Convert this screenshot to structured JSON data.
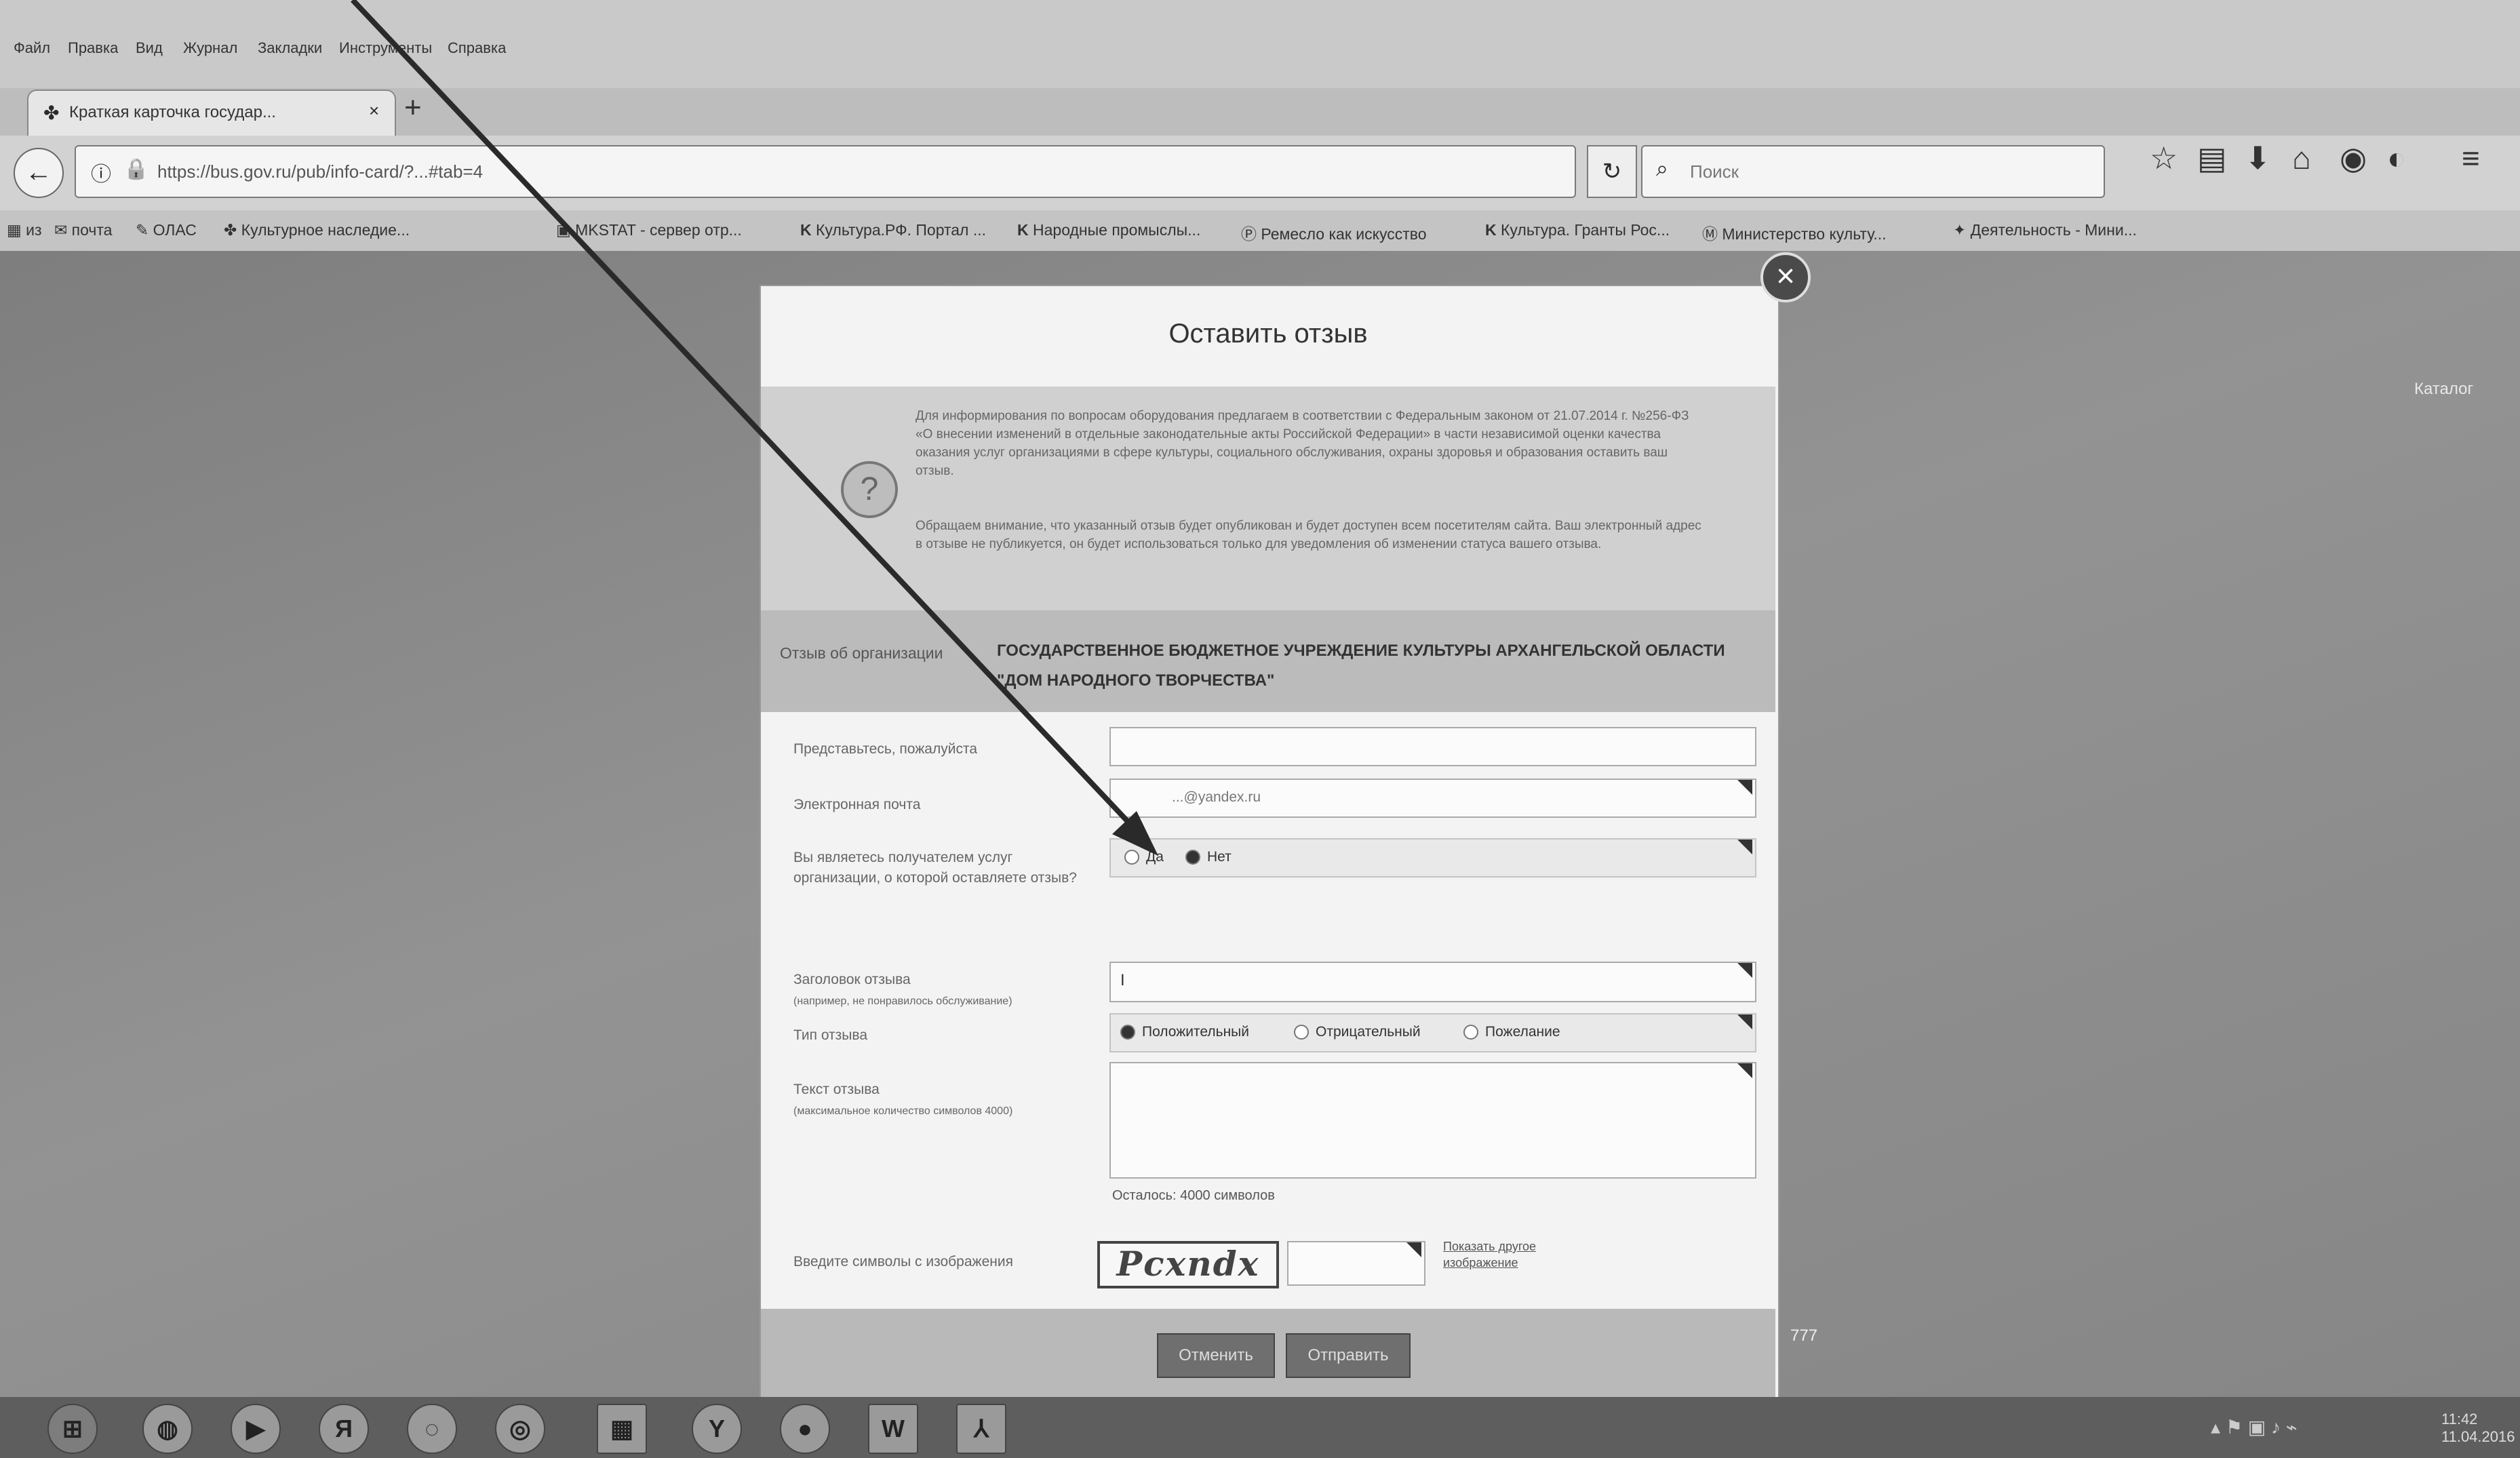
{
  "browser": {
    "menu": [
      "Файл",
      "Правка",
      "Вид",
      "Журнал",
      "Закладки",
      "Инструменты",
      "Справка"
    ],
    "tab_title": "Краткая карточка государ...",
    "tab_close": "×",
    "new_tab": "+",
    "url": "https://bus.gov.ru/pub/info-card/?...#tab=4",
    "search_placeholder": "Поиск",
    "bookmarks": [
      "из",
      "почта",
      "ОЛАС",
      "Культурное наследие...",
      "MKSTAT - сервер отр...",
      "Культура.РФ. Портал ...",
      "Народные промыслы...",
      "Ремесло как искусство",
      "Культура. Гранты Рос...",
      "Министерство культу...",
      "Деятельность - Мини..."
    ]
  },
  "modal": {
    "title": "Оставить отзыв",
    "close": "×",
    "info_paragraphs": [
      "Для информирования по вопросам оборудования предлагаем в соответствии с Федеральным законом от 21.07.2014 г. №256-ФЗ «О внесении изменений в отдельные законодательные акты Российской Федерации» в части независимой оценки качества оказания услуг организациями в сфере культуры, социального обслуживания, охраны здоровья и образования оставить ваш отзыв.",
      "Обращаем внимание, что указанный отзыв будет опубликован и будет доступен всем посетителям сайта. Ваш электронный адрес в отзыве не публикуется, он будет использоваться только для уведомления об изменении статуса вашего отзыва."
    ],
    "org_label": "Отзыв об организации",
    "org_name": "ГОСУДАРСТВЕННОЕ БЮДЖЕТНОЕ УЧРЕЖДЕНИЕ КУЛЬТУРЫ АРХАНГЕЛЬСКОЙ ОБЛАСТИ \"ДОМ НАРОДНОГО ТВОРЧЕСТВА\"",
    "fields": {
      "name_label": "Представьтесь, пожалуйста",
      "email_label": "Электронная почта",
      "email_value": "...@yandex.ru",
      "consumer_label": "Вы являетесь получателем услуг организации, о которой оставляете отзыв?",
      "consumer_yes": "Да",
      "consumer_no": "Нет",
      "subject_label": "Заголовок отзыва",
      "subject_hint": "(например, не понравилось обслуживание)",
      "subject_value": "I",
      "type_label": "Тип отзыва",
      "type_options": [
        "Положительный",
        "Отрицательный",
        "Пожелание"
      ],
      "text_label": "Текст отзыва",
      "text_hint": "(максимальное количество символов 4000)",
      "chars_left": "Осталось: 4000 символов",
      "captcha_label": "Введите символы с изображения",
      "captcha_text": "Pcxndx",
      "captcha_refresh": "Показать другое изображение"
    },
    "buttons": {
      "cancel": "Отменить",
      "submit": "Отправить"
    }
  },
  "page": {
    "side_note": "Каталог",
    "footer_note": "777"
  },
  "taskbar": {
    "icons": [
      "start-icon",
      "explorer-icon",
      "media-icon",
      "Я",
      "browser-icon",
      "chrome-icon",
      "calculator-icon",
      "Y",
      "firefox-icon",
      "W",
      "acrobat-icon"
    ],
    "yandex_letter": "Я",
    "ybrowser_letter": "Y",
    "word_letter": "W",
    "clock_time": "11:42",
    "clock_date": "11.04.2016"
  },
  "colors": {
    "overlay": "#8a8a8a",
    "modal_bg": "#f3f3f3",
    "info_bg": "#d0d0d0"
  }
}
